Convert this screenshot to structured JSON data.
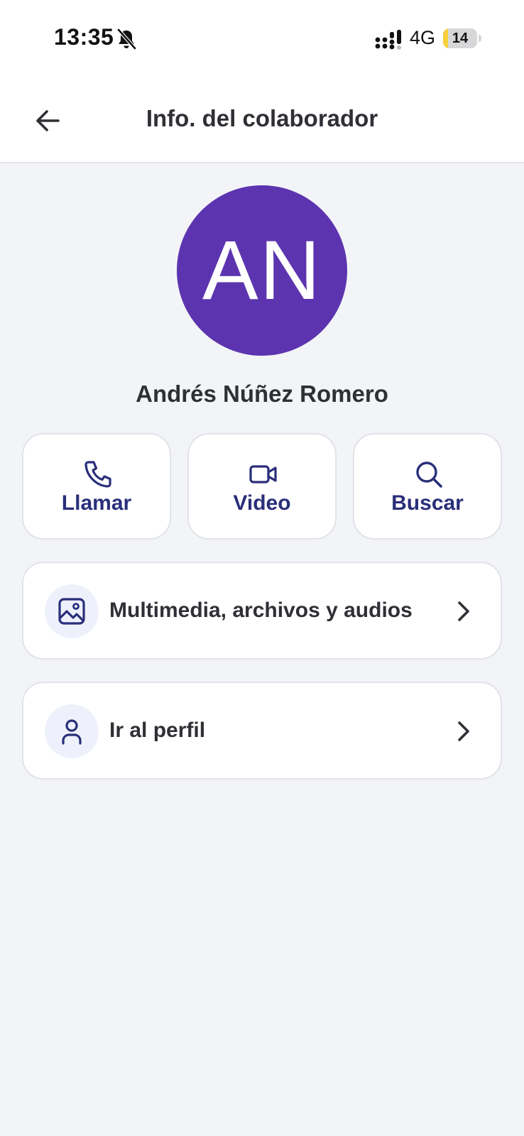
{
  "status_bar": {
    "time": "13:35",
    "network": "4G",
    "battery_level": "14",
    "battery_fraction": 0.14
  },
  "header": {
    "title": "Info. del colaborador",
    "back_icon": "arrow-left-icon"
  },
  "profile": {
    "initials": "AN",
    "name": "Andrés Núñez Romero",
    "avatar_color": "#5c34af"
  },
  "actions": [
    {
      "label": "Llamar",
      "icon": "phone-icon"
    },
    {
      "label": "Video",
      "icon": "video-camera-icon"
    },
    {
      "label": "Buscar",
      "icon": "search-icon"
    }
  ],
  "menu": [
    {
      "label": "Multimedia, archivos y audios",
      "icon": "image-icon"
    },
    {
      "label": "Ir al perfil",
      "icon": "user-icon"
    }
  ],
  "colors": {
    "accent": "#2a2f7a",
    "background": "#f3f4f7",
    "icon_bubble": "#eef1fb"
  }
}
